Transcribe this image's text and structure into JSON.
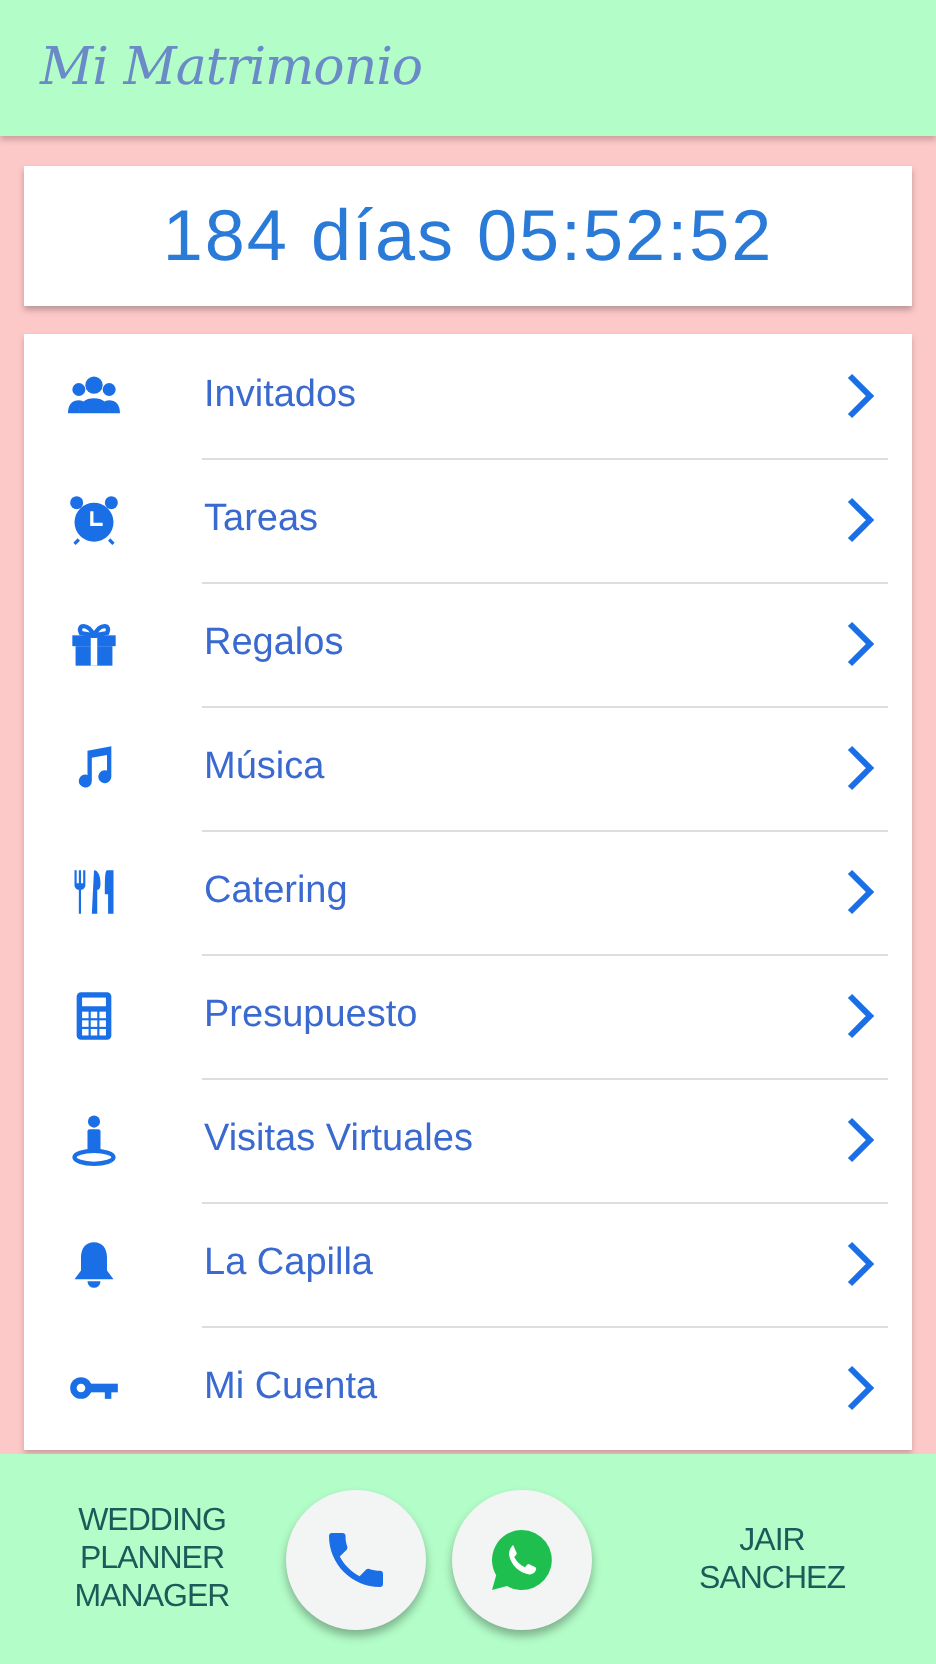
{
  "app_bar": {
    "title": "Mi Matrimonio"
  },
  "countdown": {
    "text": "184 días 05:52:52"
  },
  "menu": {
    "items": [
      {
        "label": "Invitados"
      },
      {
        "label": "Tareas"
      },
      {
        "label": "Regalos"
      },
      {
        "label": "Música"
      },
      {
        "label": "Catering"
      },
      {
        "label": "Presupuesto"
      },
      {
        "label": "Visitas Virtuales"
      },
      {
        "label": "La Capilla"
      },
      {
        "label": "Mi Cuenta"
      }
    ]
  },
  "footer": {
    "left_lines": [
      "WEDDING",
      "PLANNER",
      "MANAGER"
    ],
    "right_lines": [
      "JAIR",
      "SANCHEZ"
    ]
  }
}
